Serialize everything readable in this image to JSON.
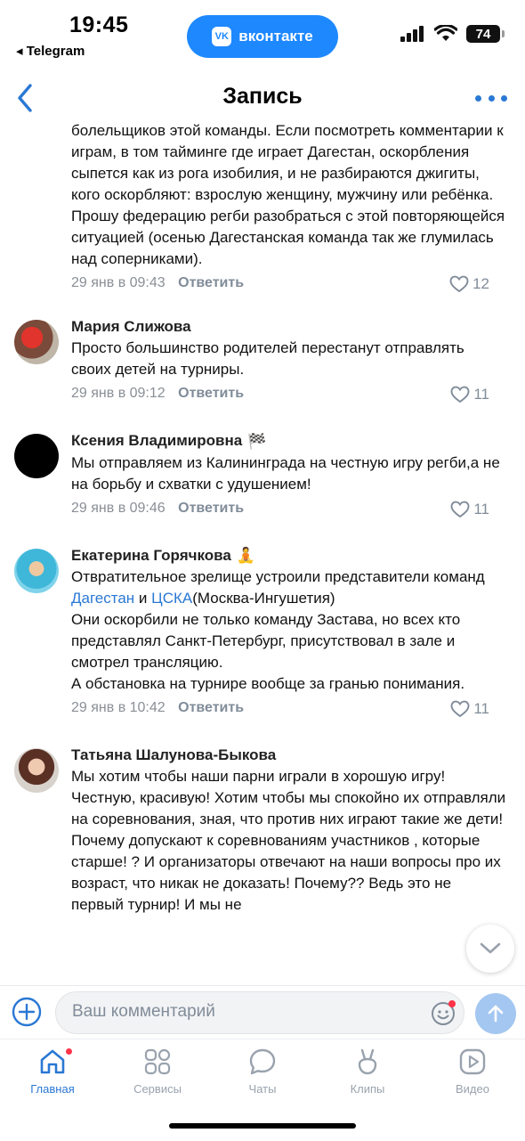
{
  "status_bar": {
    "time": "19:45",
    "back_app": "◂ Telegram",
    "pill_label": "вконтакте",
    "battery": "74"
  },
  "header": {
    "title": "Запись"
  },
  "comments": [
    {
      "text": "болельщиков этой команды. Если посмотреть комментарии к  играм,    в том тайминге где играет Дагестан, оскорбления сыпется как из рога изобилия, и не разбираются джигиты, кого оскорбляют: взрослую женщину, мужчину или ребёнка. Прошу федерацию регби разобраться  с этой повторяющейся ситуацией (осенью Дагестанская команда так же глумилась над соперниками).",
      "date": "29 янв в 09:43",
      "reply": "Ответить",
      "likes": "12"
    },
    {
      "author": "Мария Слижова",
      "text": "Просто большинство родителей перестанут отправлять своих детей на турниры.",
      "date": "29 янв в 09:12",
      "reply": "Ответить",
      "likes": "11"
    },
    {
      "author": "Ксения Владимировна",
      "emoji": "🏁",
      "text": "Мы отправляем из Калининграда на честную игру регби,а не на борьбу и схватки с удушением!",
      "date": "29 янв в 09:46",
      "reply": "Ответить",
      "likes": "11"
    },
    {
      "author": "Екатерина Горячкова",
      "emoji": "🧘",
      "text_parts": [
        "Отвратительное зрелище устроили представители команд ",
        "Дагестан",
        " и  ",
        "ЦСКА",
        "(Москва-Ингушетия)\nОни оскорбили не только команду Застава, но всех кто представлял Санкт-Петербург, присутствовал в зале и смотрел трансляцию.\nА обстановка на турнире вообще за гранью понимания."
      ],
      "date": "29 янв в 10:42",
      "reply": "Ответить",
      "likes": "11"
    },
    {
      "author": "Татьяна Шалунова-Быкова",
      "text": "Мы хотим чтобы наши парни играли в хорошую игру!  Честную, красивую! Хотим чтобы мы спокойно их отправляли на соревнования, зная, что против них играют такие же дети!  Почему допускают к соревнованиям участников , которые старше! ? И организаторы отвечают на наши вопросы про их возраст, что никак не доказать! Почему?? Ведь это не первый турнир! И мы не"
    }
  ],
  "composer": {
    "placeholder": "Ваш комментарий"
  },
  "tabs": [
    {
      "label": "Главная",
      "icon": "home-icon",
      "active": true
    },
    {
      "label": "Сервисы",
      "icon": "services-icon"
    },
    {
      "label": "Чаты",
      "icon": "chat-icon"
    },
    {
      "label": "Клипы",
      "icon": "clips-icon"
    },
    {
      "label": "Видео",
      "icon": "video-icon"
    }
  ],
  "colors": {
    "accent": "#2a78d4",
    "vk_blue": "#1e88ff",
    "meta": "#818c99",
    "badge": "#ff3347"
  }
}
